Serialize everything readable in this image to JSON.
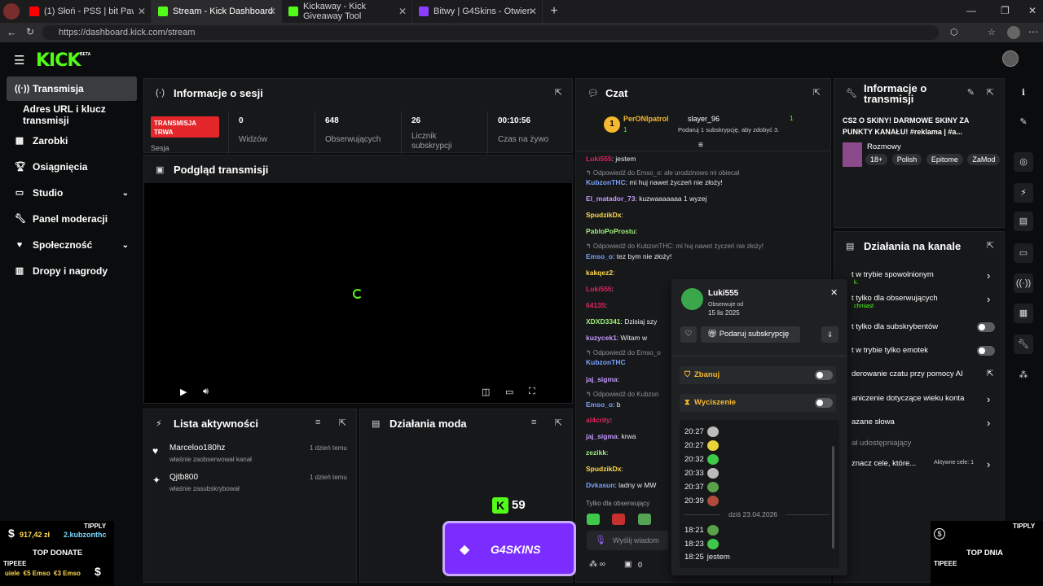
{
  "browser": {
    "tabs": [
      {
        "label": "(1) Słoń - PSS | bit Pawko, skr",
        "color": "#ff0000"
      },
      {
        "label": "Stream - Kick Dashboard",
        "color": "#53fc18"
      },
      {
        "label": "Kickaway - Kick Giveaway Tool",
        "color": "#53fc18"
      },
      {
        "label": "Bitwy | G4Skins - Otwieraj skrzynki",
        "color": "#8b3dff"
      }
    ],
    "url": "https://dashboard.kick.com/stream"
  },
  "brand": {
    "logo": "KICK",
    "beta": "BETA"
  },
  "sidebar": {
    "items": [
      {
        "label": "Transmisja",
        "icon": "broadcast-icon"
      },
      {
        "label": "Adres URL i klucz transmisji",
        "icon": ""
      },
      {
        "label": "Zarobki",
        "icon": "earnings-icon"
      },
      {
        "label": "Osiągnięcia",
        "icon": "trophy-icon"
      },
      {
        "label": "Studio",
        "icon": "studio-icon"
      },
      {
        "label": "Panel moderacji",
        "icon": "wrench-icon"
      },
      {
        "label": "Społeczność",
        "icon": "community-icon"
      },
      {
        "label": "Dropy i nagrody",
        "icon": "drops-icon"
      }
    ]
  },
  "session": {
    "title": "Informacje o sesji",
    "live_badge": "TRANSMISJA TRWA",
    "session_label": "Sesja",
    "stats": [
      {
        "value": "0",
        "label": "Widzów"
      },
      {
        "value": "648",
        "label": "Obserwujących"
      },
      {
        "value": "26",
        "label": "Licznik subskrypcji"
      },
      {
        "value": "00:10:56",
        "label": "Czas na żywo"
      }
    ]
  },
  "preview": {
    "title": "Podgląd transmisji"
  },
  "activity": {
    "title": "Lista aktywności",
    "items": [
      {
        "name": "Marceloo180hz",
        "text": "właśnie zaobserwował kanał",
        "time": "1 dzień temu"
      },
      {
        "name": "Qjtb800",
        "text": "właśnie zasubskrybował",
        "time": "1 dzień temu"
      }
    ]
  },
  "modactions": {
    "title": "Działania moda"
  },
  "chat": {
    "title": "Czat",
    "pinned": {
      "rank": "1",
      "user1": "PerONIpatrol",
      "count1": "1",
      "user2": "slayer_96",
      "count2": "1",
      "gift_text": "Podaruj 1 subskrypcję, aby zdobyć 3."
    },
    "lines": [
      {
        "user": "Luki555",
        "text": ": jestem",
        "color": "#e0245e"
      },
      {
        "reply": "Odpowiedź do Emso_o: ale urodzinowo mi obiecał"
      },
      {
        "user": "KubzonTHC",
        "text": ": mi huj nawet życzeń nie złoży!",
        "color": "#7aa2ff"
      },
      {
        "user": "El_matador_73",
        "text": ": kuzwaaaaaaa 1 wyzej",
        "color": "#c59aff"
      },
      {
        "user": "SpudzikDx",
        "text": ":",
        "color": "#ffd84d"
      },
      {
        "user": "PabloPoProstu",
        "text": ":",
        "color": "#9ef07a"
      },
      {
        "reply": "Odpowiedź do KubzonTHC: mi huj nawet życzeń nie złoży!"
      },
      {
        "user": "Emso_o",
        "text": ": tez bym nie złoży!",
        "color": "#7aa2ff"
      },
      {
        "user": "kakqez2",
        "text": ":",
        "color": "#ffd84d"
      },
      {
        "user": "Luki555",
        "text": ":",
        "color": "#e0245e"
      },
      {
        "user": "64135",
        "text": ":",
        "color": "#e0245e"
      },
      {
        "user": "XDXD3341",
        "text": ": Dzisiaj szy",
        "color": "#9ef07a"
      },
      {
        "user": "kuzycek1",
        "text": ": Witam w",
        "color": "#c59aff"
      },
      {
        "reply": "Odpowiedź do Emso_o"
      },
      {
        "user": "KubzonTHC",
        "text": "",
        "color": "#7aa2ff"
      },
      {
        "user": "jaj_sigma",
        "text": ":",
        "color": "#c59aff"
      },
      {
        "reply": "Odpowiedź do Kubzon"
      },
      {
        "user": "Emso_o",
        "text": ": b",
        "color": "#7aa2ff"
      },
      {
        "user": "al4crity",
        "text": ":",
        "color": "#e0245e"
      },
      {
        "user": "jaj_sigma",
        "text": ": krwa",
        "color": "#c59aff"
      },
      {
        "user": "zezikk",
        "text": ":",
        "color": "#9ef07a"
      },
      {
        "user": "SpudzikDx",
        "text": ":",
        "color": "#ffd84d"
      },
      {
        "user": "Dvkasun",
        "text": ": ladny w MW",
        "color": "#7aa2ff"
      }
    ],
    "followers_only": "Tylko dla obserwujący",
    "input_placeholder": "Wyślij wiadom",
    "points": "0"
  },
  "stream_info": {
    "title": "Informacje o transmisji",
    "stream_title": "CS2 O SKINY! DARMOWE SKINY ZA PUNKTY KANAŁU! #reklama | #a...",
    "category": "Rozmowy",
    "tags": [
      "18+",
      "Polish",
      "Epitome",
      "ZaMod"
    ]
  },
  "channel_actions": {
    "title": "Działania na kanale",
    "rows": [
      {
        "label": "t w trybie spowolnionym",
        "sub": "k.",
        "control": "chevron"
      },
      {
        "label": "t tylko dla obserwujących",
        "sub": "chmiast",
        "control": "chevron"
      },
      {
        "label": "t tylko dla subskrybentów",
        "sub": "",
        "control": "toggle"
      },
      {
        "label": "t w trybie tylko emotek",
        "sub": "",
        "control": "toggle"
      },
      {
        "label": "derowanie czatu przy pomocy AI",
        "sub": "",
        "control": "external"
      },
      {
        "label": "aniczenie dotyczące wieku konta",
        "sub": "",
        "control": "chevron"
      },
      {
        "label": "azane słowa",
        "sub": "",
        "control": "chevron"
      },
      {
        "label": "ał udostępniający",
        "sub": "",
        "control": "none"
      },
      {
        "label": "znacz cele, które...",
        "sub": "Aktywne cele: 1",
        "control": "chevron"
      }
    ]
  },
  "user_popup": {
    "username": "Luki555",
    "follow_label": "Obserwuje od",
    "follow_date": "15 lis 2025",
    "gift_button": "Podaruj subskrypcję",
    "ban_label": "Zbanuj",
    "timeout_label": "Wyciszenie",
    "history": [
      {
        "time": "20:27",
        "text": ""
      },
      {
        "time": "20:27",
        "text": ""
      },
      {
        "time": "20:32",
        "text": ""
      },
      {
        "time": "20:33",
        "text": ""
      },
      {
        "time": "20:37",
        "text": ""
      },
      {
        "time": "20:39",
        "text": ""
      },
      {
        "time": "18:21",
        "text": ""
      },
      {
        "time": "18:23",
        "text": ""
      },
      {
        "time": "18:25",
        "text": "jestem"
      }
    ],
    "date_divider": "dziś 23.04.2026"
  },
  "overlays": {
    "tipply_left": "TIPPLY",
    "tip_amount": "917,42 zł",
    "tip_user": "2.kubzonthc",
    "top_donate": "TOP DONATE",
    "tipeee_left": "TIPEEE",
    "ticker": "uiele  €5 Emso  €3 Emso",
    "kick_count": "59",
    "g4skins": "G4SKINS",
    "tipply_right": "TIPPLY",
    "top_dnia": "TOP DNIA",
    "tipeee_right": "TIPEEE"
  },
  "colors": {
    "kick_green": "#53fc18",
    "live_red": "#e3262a",
    "g4_purple": "#7b2cff"
  }
}
